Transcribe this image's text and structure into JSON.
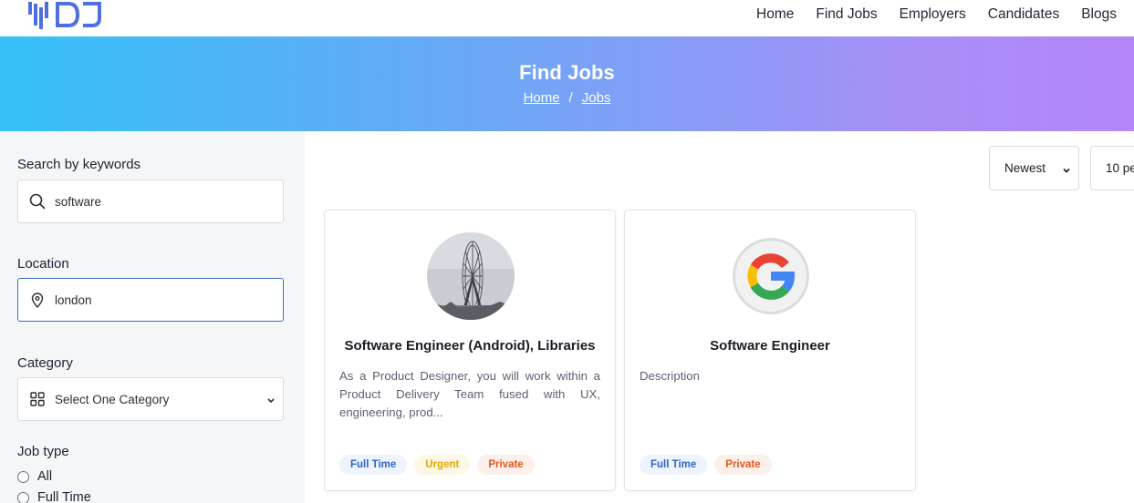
{
  "nav": {
    "logo_text": "DJ",
    "items": [
      "Home",
      "Find Jobs",
      "Employers",
      "Candidates",
      "Blogs"
    ]
  },
  "banner": {
    "title": "Find Jobs",
    "breadcrumb": [
      "Home",
      "Jobs"
    ],
    "separator": "/"
  },
  "filters": {
    "keywords_label": "Search by keywords",
    "keywords_value": "software",
    "location_label": "Location",
    "location_value": "london",
    "category_label": "Category",
    "category_value": "Select One Category",
    "job_type_label": "Job type",
    "job_type_options": [
      "All",
      "Full Time"
    ]
  },
  "sort": {
    "order_value": "Newest",
    "per_page_value": "10 pe"
  },
  "jobs": [
    {
      "title": "Software Engineer (Android), Libraries",
      "description": "As a Product Designer, you will work within a Product Delivery Team fused with UX, engineering, prod...",
      "logo": "ferris-wheel-photo",
      "tags": [
        "Full Time",
        "Urgent",
        "Private"
      ]
    },
    {
      "title": "Software Engineer",
      "description": "Description",
      "logo": "google-logo",
      "tags": [
        "Full Time",
        "Private"
      ]
    }
  ],
  "colors": {
    "banner_start": "#35c1f8",
    "banner_end": "#b486f8",
    "tag_blue": "#2f63c7",
    "tag_yellow": "#e0a800",
    "tag_orange": "#e2581c",
    "focus_border": "#3b6ec2"
  }
}
